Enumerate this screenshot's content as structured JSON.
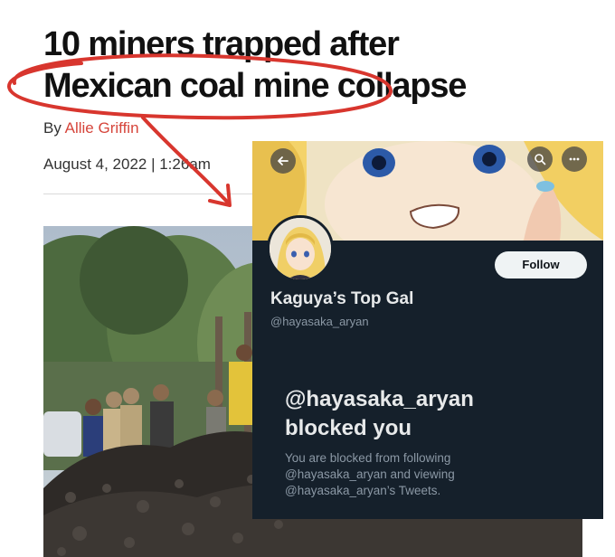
{
  "article": {
    "headline_line1": "10 miners trapped after",
    "headline_line2": "Mexican coal mine collapse",
    "byline_prefix": "By",
    "author": "Allie Griffin",
    "date": "August 4, 2022 | 1:26am"
  },
  "profile": {
    "display_name": "Kaguya’s Top Gal",
    "handle": "@hayasaka_aryan",
    "follow_label": "Follow",
    "blocked_title_line1": "@hayasaka_aryan",
    "blocked_title_line2": "blocked you",
    "blocked_desc_line1": "You are blocked from following",
    "blocked_desc_line2": "@hayasaka_aryan and viewing",
    "blocked_desc_line3": "@hayasaka_aryan’s Tweets."
  },
  "icons": {
    "back": "back-arrow-icon",
    "search": "search-icon",
    "more": "more-icon"
  },
  "colors": {
    "author_link": "#d6453b",
    "annotation_red": "#d8362e",
    "card_background": "#15202b",
    "follow_button": "#eff3f4"
  }
}
